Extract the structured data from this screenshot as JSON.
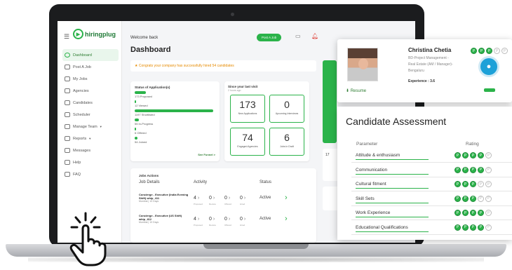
{
  "sidebar": {
    "brand": "hiringplug",
    "items": [
      {
        "label": "Dashboard",
        "icon": "dashboard-icon",
        "active": true
      },
      {
        "label": "Post A Job",
        "icon": "post-job-icon"
      },
      {
        "label": "My Jobs",
        "icon": "jobs-icon"
      },
      {
        "label": "Agencies",
        "icon": "agencies-icon"
      },
      {
        "label": "Candidates",
        "icon": "candidates-icon"
      },
      {
        "label": "Scheduler",
        "icon": "calendar-icon"
      },
      {
        "label": "Manage Team",
        "icon": "team-icon",
        "caret": true
      },
      {
        "label": "Reports",
        "icon": "reports-icon",
        "caret": true
      },
      {
        "label": "Messages",
        "icon": "messages-icon"
      },
      {
        "label": "Help",
        "icon": "help-icon"
      },
      {
        "label": "FAQ",
        "icon": "faq-icon"
      }
    ]
  },
  "header": {
    "welcome": "Welcome back",
    "title": "Dashboard",
    "post_job": "Post A Job"
  },
  "banner": "★ Congrats your company has successfully hired 54 candidates",
  "status": {
    "title": "Status of Application(s)",
    "rows": [
      {
        "label": "173 Proposed",
        "fraction": 0.14
      },
      {
        "label": "12 Viewed",
        "fraction": 0.01
      },
      {
        "label": "1197 Shortlisted",
        "fraction": 1.0
      },
      {
        "label": "55 In-Progress",
        "fraction": 0.05
      },
      {
        "label": "6 Offered",
        "fraction": 0.01
      },
      {
        "label": "54 Joined",
        "fraction": 0.04
      }
    ],
    "see_funnel": "See Funnel >"
  },
  "last_visit": {
    "title": "Since your last visit",
    "subtitle": "2 hours ago",
    "metrics": [
      {
        "value": "173",
        "label": "New Applications"
      },
      {
        "value": "0",
        "label": "Upcoming Interviews"
      },
      {
        "value": "74",
        "label": "Engaged Agencies"
      },
      {
        "value": "6",
        "label": "Jobs in Draft"
      }
    ]
  },
  "jobs": {
    "title": "Jobs Actions",
    "headers": {
      "details": "Job Details",
      "activity": "Activity",
      "status": "Status"
    },
    "activity_labels": [
      "Proposed",
      "Review",
      "Offered",
      "Hired"
    ],
    "rows": [
      {
        "title": "Concierge - Executive (India Evening Shift) whip_411",
        "meta": "Mumbai | 10 Days",
        "counts": [
          "4",
          "0",
          "0",
          "0"
        ],
        "status": "Active"
      },
      {
        "title": "Concierge - Executive (US Shift) whip_412",
        "meta": "Mumbai | 10 Days",
        "counts": [
          "4",
          "0",
          "0",
          "0"
        ],
        "status": "Active"
      }
    ]
  },
  "side_number": "17",
  "profile": {
    "name": "Christina Chetia",
    "role_line1": "BD-Project Management -",
    "role_line2": "Real Estate (AM / Manager)-",
    "location": "Bengaluru",
    "experience": "Experience : 3.6",
    "resume": "Resume",
    "top_stars": 5
  },
  "assessment": {
    "title": "Candidate Assessment",
    "param_header": "Parameter",
    "rating_header": "Rating",
    "rows": [
      {
        "label": "Attitude & enthusiasm",
        "rating": 4
      },
      {
        "label": "Communication",
        "rating": 4
      },
      {
        "label": "Cultural fitment",
        "rating": 3
      },
      {
        "label": "Skill Sets",
        "rating": 3
      },
      {
        "label": "Work Experience",
        "rating": 4
      },
      {
        "label": "Educational Qualifications",
        "rating": 4
      }
    ],
    "max_rating": 4
  },
  "colors": {
    "accent": "#2bb34a",
    "warning": "#e68a00",
    "bezel": "#1b1c1e"
  }
}
